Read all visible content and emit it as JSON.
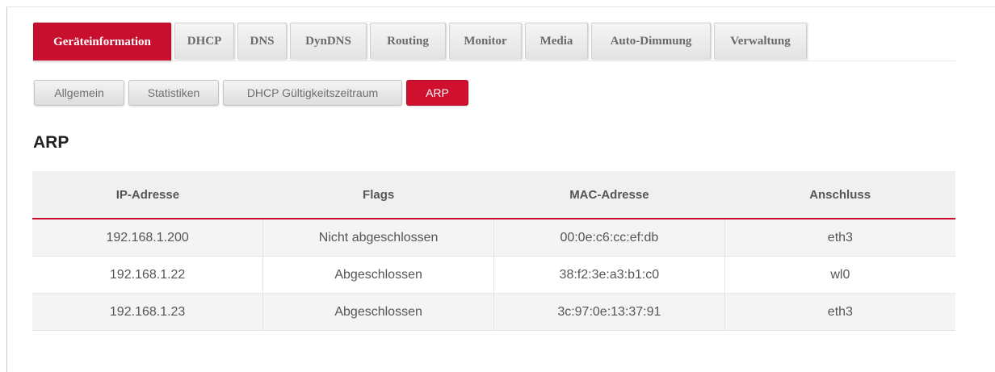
{
  "tabs": {
    "main": [
      {
        "label": "Geräteinformation",
        "active": true
      },
      {
        "label": "DHCP",
        "active": false
      },
      {
        "label": "DNS",
        "active": false
      },
      {
        "label": "DynDNS",
        "active": false
      },
      {
        "label": "Routing",
        "active": false
      },
      {
        "label": "Monitor",
        "active": false
      },
      {
        "label": "Media",
        "active": false
      },
      {
        "label": "Auto-Dimmung",
        "active": false
      },
      {
        "label": "Verwaltung",
        "active": false
      }
    ],
    "sub": [
      {
        "label": "Allgemein",
        "active": false
      },
      {
        "label": "Statistiken",
        "active": false
      },
      {
        "label": "DHCP Gültigkeitszeitraum",
        "active": false
      },
      {
        "label": "ARP",
        "active": true
      }
    ]
  },
  "page": {
    "title": "ARP"
  },
  "table": {
    "headers": [
      "IP-Adresse",
      "Flags",
      "MAC-Adresse",
      "Anschluss"
    ],
    "rows": [
      [
        "192.168.1.200",
        "Nicht abgeschlossen",
        "00:0e:c6:cc:ef:db",
        "eth3"
      ],
      [
        "192.168.1.22",
        "Abgeschlossen",
        "38:f2:3e:a3:b1:c0",
        "wl0"
      ],
      [
        "192.168.1.23",
        "Abgeschlossen",
        "3c:97:0e:13:37:91",
        "eth3"
      ]
    ]
  },
  "colors": {
    "accent": "#c8102e",
    "header_bg": "#f0f0f0",
    "tab_bg": "#e8e8e8"
  }
}
